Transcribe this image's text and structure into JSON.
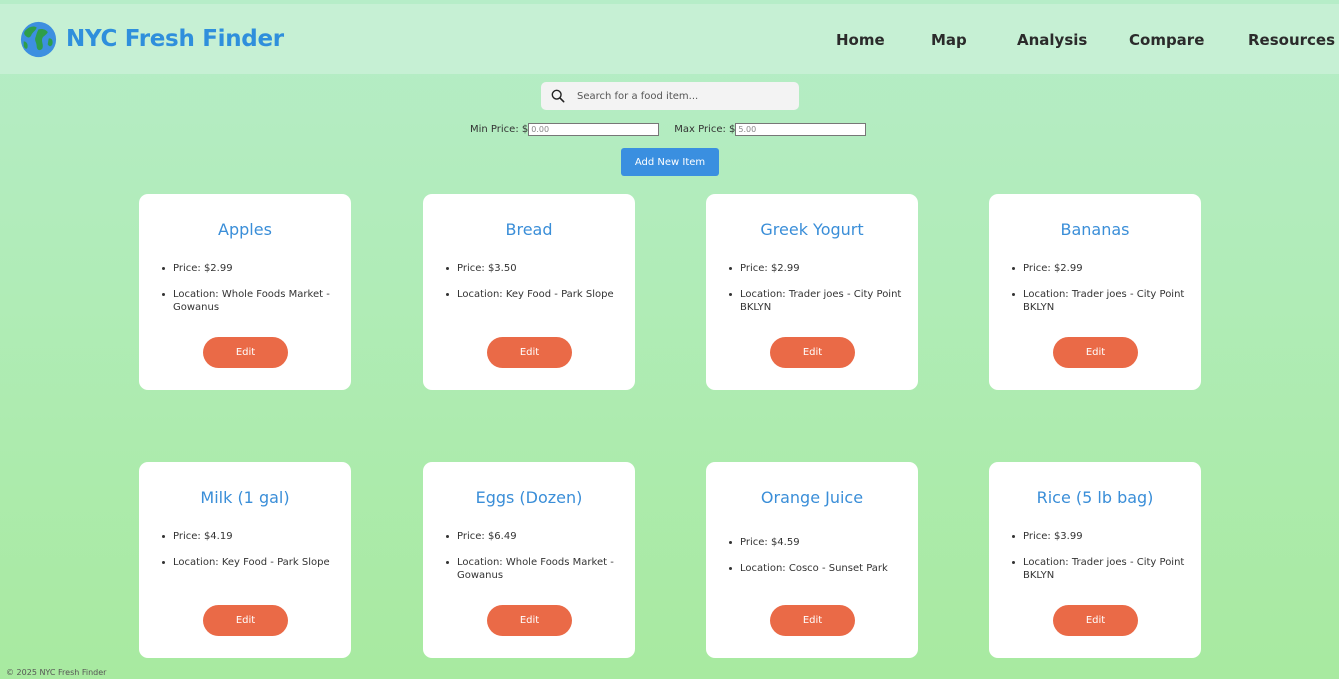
{
  "header": {
    "brand": "NYC Fresh Finder",
    "logo_icon": "globe-icon",
    "nav": [
      "Home",
      "Map",
      "Analysis",
      "Compare",
      "Resources"
    ]
  },
  "search": {
    "placeholder": "Search for a food item...",
    "icon": "search-icon"
  },
  "filters": {
    "min_label": "Min Price: $",
    "min_placeholder": "0.00",
    "max_label": "Max Price: $",
    "max_placeholder": "5.00"
  },
  "add_button": "Add New Item",
  "items": [
    {
      "name": "Apples",
      "price": "Price: $2.99",
      "location": "Location: Whole Foods Market - Gowanus",
      "edit": "Edit"
    },
    {
      "name": "Bread",
      "price": "Price: $3.50",
      "location": "Location: Key Food - Park Slope",
      "edit": "Edit"
    },
    {
      "name": "Greek Yogurt",
      "price": "Price: $2.99",
      "location": "Location: Trader joes - City Point BKLYN",
      "edit": "Edit"
    },
    {
      "name": "Bananas",
      "price": "Price: $2.99",
      "location": "Location: Trader joes - City Point BKLYN",
      "edit": "Edit"
    },
    {
      "name": "Milk (1 gal)",
      "price": "Price: $4.19",
      "location": "Location: Key Food - Park Slope",
      "edit": "Edit"
    },
    {
      "name": "Eggs (Dozen)",
      "price": "Price: $6.49",
      "location": "Location: Whole Foods Market - Gowanus",
      "edit": "Edit"
    },
    {
      "name": "Orange Juice",
      "price": "Price: $4.59",
      "location": "Location: Cosco - Sunset Park",
      "edit": "Edit"
    },
    {
      "name": "Rice (5 lb bag)",
      "price": "Price: $3.99",
      "location": "Location: Trader joes - City Point BKLYN",
      "edit": "Edit"
    }
  ],
  "footer": "© 2025 NYC Fresh Finder",
  "colors": {
    "brand": "#2f8fdc",
    "edit_button": "#ea6a47",
    "add_button": "#3a8fe0",
    "card_title": "#3a8ed8"
  }
}
